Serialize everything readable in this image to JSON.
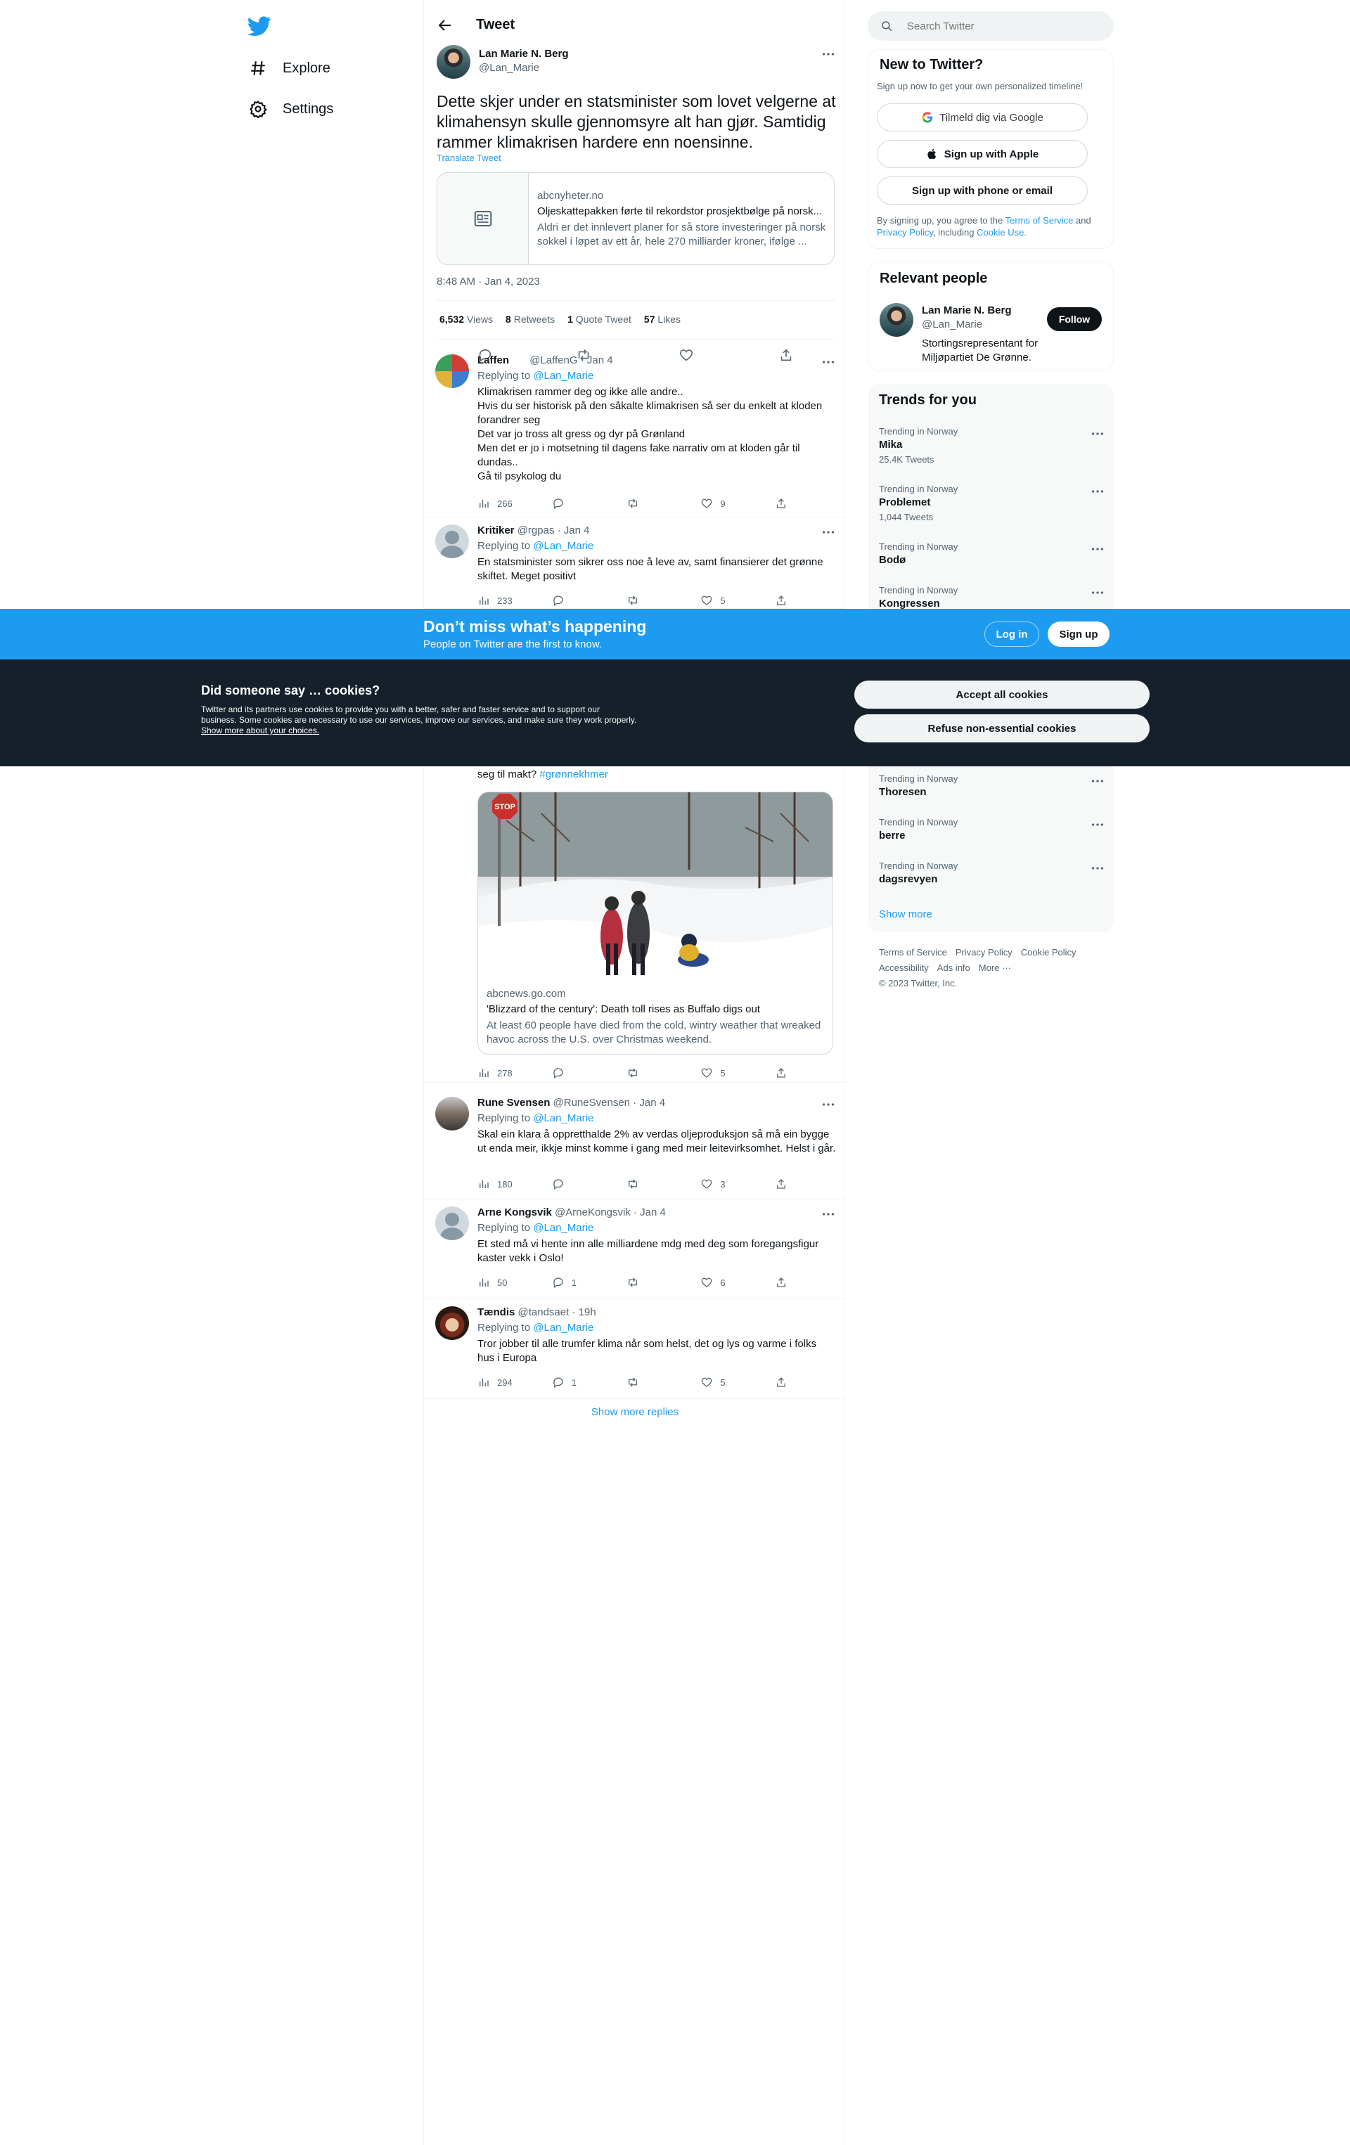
{
  "nav": {
    "explore": "Explore",
    "settings": "Settings"
  },
  "header": {
    "title": "Tweet"
  },
  "main_tweet": {
    "author_name": "Lan Marie N. Berg",
    "author_handle": "@Lan_Marie",
    "text": "Dette skjer under en statsminister som lovet velgerne at klimahensyn skulle gjennomsyre alt han gjør. Samtidig rammer klimakrisen hardere enn noensinne.",
    "translate": "Translate Tweet",
    "card": {
      "domain": "abcnyheter.no",
      "title": "Oljeskattepakken førte til rekordstor prosjektbølge på norsk...",
      "description": "Aldri er det innlevert planer for så store investeringer på norsk sokkel i løpet av ett år, hele 270 milliarder kroner, ifølge ..."
    },
    "timestamp": "8:48 AM · Jan 4, 2023",
    "stats": {
      "views_count": "6,532",
      "views_label": "Views",
      "retweets_count": "8",
      "retweets_label": "Retweets",
      "quotes_count": "1",
      "quotes_label": "Quote Tweet",
      "likes_count": "57",
      "likes_label": "Likes"
    }
  },
  "replies": [
    {
      "name": "Laffen",
      "handle": "@LaffenG",
      "date": "· Jan 4",
      "replying_label": "Replying to",
      "replying_to": "@Lan_Marie",
      "text": "Klimakrisen rammer deg og ikke alle andre..\nHvis du ser historisk på den såkalte klimakrisen så ser du enkelt at kloden forandrer seg\nDet var jo tross alt gress og dyr på Grønland\nMen det er jo i motsetning til dagens fake narrativ om at kloden går til dundas..\nGå til psykolog du",
      "views": "266",
      "replies": "",
      "retweets": "",
      "likes": "9"
    },
    {
      "name": "Kritiker",
      "handle": "@rgpas",
      "date": "· Jan 4",
      "replying_label": "Replying to",
      "replying_to": "@Lan_Marie",
      "text": "En statsminister som sikrer oss noe å leve av, samt finansierer det grønne skiftet.  Meget positivt",
      "views": "233",
      "replies": "",
      "retweets": "",
      "likes": "5"
    },
    {
      "text_tail": "seg til makt?",
      "hashtag": "#grønnekhmer",
      "card_domain": "abcnews.go.com",
      "card_title": "'Blizzard of the century': Death toll rises as Buffalo digs out",
      "card_desc": "At least 60 people have died from the cold, wintry weather that wreaked havoc across the U.S. over Christmas weekend.",
      "views": "278",
      "replies": "",
      "retweets": "",
      "likes": "5"
    },
    {
      "name": "Rune Svensen",
      "handle": "@RuneSvensen",
      "date": "· Jan 4",
      "replying_label": "Replying to",
      "replying_to": "@Lan_Marie",
      "text": "Skal ein klara å oppretthalde 2% av verdas oljeproduksjon så må ein bygge ut enda meir, ikkje minst komme i gang med meir leitevirksomhet. Helst i går.",
      "views": "180",
      "replies": "",
      "retweets": "",
      "likes": "3"
    },
    {
      "name": "Arne Kongsvik",
      "handle": "@ArneKongsvik",
      "date": "· Jan 4",
      "replying_label": "Replying to",
      "replying_to": "@Lan_Marie",
      "text": "Et sted må vi hente inn alle milliardene mdg med deg som foregangsfigur kaster vekk i Oslo!",
      "views": "50",
      "replies": "1",
      "retweets": "",
      "likes": "6"
    },
    {
      "name": "Tændis",
      "handle": "@tandsaet",
      "date": "· 19h",
      "replying_label": "Replying to",
      "replying_to": "@Lan_Marie",
      "text": "Tror jobber til alle trumfer klima når som helst, det og lys og varme i folks hus i Europa",
      "views": "294",
      "replies": "1",
      "retweets": "",
      "likes": "5"
    }
  ],
  "show_more_replies": "Show more replies",
  "right": {
    "search_placeholder": "Search Twitter",
    "new_to_twitter": {
      "title": "New to Twitter?",
      "subtitle": "Sign up now to get your own personalized timeline!",
      "google": "Tilmeld dig via Google",
      "apple": "Sign up with Apple",
      "phone": "Sign up with phone or email",
      "terms_1": "By signing up, you agree to the ",
      "terms_link": "Terms of Service",
      "terms_2": " and ",
      "privacy_link": "Privacy Policy",
      "terms_3": ", including ",
      "cookie_link": "Cookie Use."
    },
    "relevant_people": {
      "title": "Relevant people",
      "name": "Lan Marie N. Berg",
      "handle": "@Lan_Marie",
      "follow": "Follow",
      "bio": "Stortingsrepresentant for Miljøpartiet De Grønne."
    },
    "trends": {
      "title": "Trends for you",
      "items": [
        {
          "context": "Trending in Norway",
          "name": "Mika",
          "count": "25.4K Tweets"
        },
        {
          "context": "Trending in Norway",
          "name": "Problemet",
          "count": "1,044 Tweets"
        },
        {
          "context": "Trending in Norway",
          "name": "Bodø",
          "count": ""
        },
        {
          "context": "Trending in Norway",
          "name": "Kongressen",
          "count": ""
        },
        {
          "context": "Trending in Norway",
          "name": "Thoresen",
          "count": ""
        },
        {
          "context": "Trending in Norway",
          "name": "berre",
          "count": ""
        },
        {
          "context": "Trending in Norway",
          "name": "dagsrevyen",
          "count": ""
        }
      ],
      "show_more": "Show more"
    },
    "footer": {
      "terms": "Terms of Service",
      "privacy": "Privacy Policy",
      "cookie": "Cookie Policy",
      "accessibility": "Accessibility",
      "ads": "Ads info",
      "more": "More ···",
      "copyright": "© 2023 Twitter, Inc."
    }
  },
  "signup_bar": {
    "title": "Don’t miss what’s happening",
    "subtitle": "People on Twitter are the first to know.",
    "login": "Log in",
    "signup": "Sign up"
  },
  "cookies": {
    "title": "Did someone say … cookies?",
    "body": "Twitter and its partners use cookies to provide you with a better, safer and faster service and to support our business. Some cookies are necessary to use our services, improve our services, and make sure they work properly. ",
    "link": "Show more about your choices.",
    "accept": "Accept all cookies",
    "refuse": "Refuse non-essential cookies"
  },
  "colors": {
    "accent": "#1d9bf0",
    "text": "#0f1419",
    "muted": "#536471",
    "cookie_bg": "#15202b"
  }
}
